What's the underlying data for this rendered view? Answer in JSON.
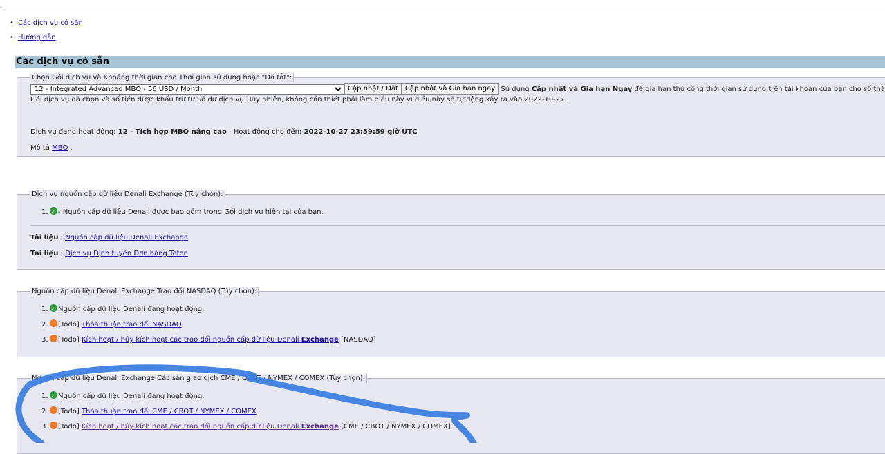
{
  "toc": [
    {
      "label": "Các dịch vụ có sẵn"
    },
    {
      "label": "Hướng dẫn"
    }
  ],
  "section_title": "Các dịch vụ có sẵn",
  "plan": {
    "legend": "Chọn Gói dịch vụ và Khoảng thời gian cho Thời gian sử dụng hoặc \"Đã tắt\":",
    "select_value": "12 - Integrated Advanced MBO - 56 USD / Month",
    "update_button": "Cập nhật / Đặt",
    "renew_button": "Cập nhật và Gia hạn ngay",
    "info_pre": "Sử dụng",
    "info_bold": "Cập nhật và Gia hạn Ngay",
    "info_mid": "để gia hạn",
    "info_link": "thủ công",
    "info_post": "thời gian sử dụng trên tài khoản của bạn cho số tháng v",
    "info_line2": "Gói dịch vụ đã chọn và số tiền được khấu trừ từ Số dư dịch vụ. Tuy nhiên, không cần thiết phải làm điều này vì điều này sẽ tự động xảy ra vào 2022-10-27.",
    "active_label": "Dịch vụ đang hoạt động:",
    "active_value": "12 - Tích hợp MBO nâng cao",
    "active_mid": "- Hoạt động cho đến:",
    "active_until": "2022-10-27 23:59:59 giờ UTC",
    "desc_label": "Mô tả",
    "desc_link": "MBO",
    "desc_end": "."
  },
  "denali": {
    "legend": "Dịch vụ nguồn cấp dữ liệu Denali Exchange (Tùy chọn):",
    "item1_text": "- Nguồn cấp dữ liệu Denali được bao gồm trong Gói dịch vụ hiện tại của bạn.",
    "doc_label": "Tài liệu",
    "doc_sep": ":",
    "doc1_link": "Nguồn cấp dữ liệu Denali Exchange",
    "doc2_link": "Dịch vụ Định tuyến Đơn hàng Teton"
  },
  "nasdaq": {
    "legend": "Nguồn cấp dữ liệu Denali Exchange Trao đổi NASDAQ (Tùy chọn):",
    "item1_text": "Nguồn cấp dữ liệu Denali đang hoạt động.",
    "todo": "[Todo]",
    "item2_link": "Thỏa thuận trao đổi NASDAQ",
    "item3_link": "Kích hoạt / hủy kích hoạt các trao đổi nguồn cấp dữ liệu Denali",
    "item3_bold": "Exchange",
    "item3_suffix": "[NASDAQ]"
  },
  "cme": {
    "legend": "Nguồn cấp dữ liệu Denali Exchange Các sàn giao dịch CME / CBOT / NYMEX / COMEX (Tùy chọn):",
    "item1_text": "Nguồn cấp dữ liệu Denali đang hoạt động.",
    "todo": "[Todo]",
    "item2_link": "Thỏa thuận trao đổi CME / CBOT / NYMEX / COMEX",
    "item3_link": "Kích hoạt / hủy kích hoạt các trao đổi nguồn cấp dữ liệu Denali",
    "item3_bold": "Exchange",
    "item3_suffix": "[CME / CBOT / NYMEX / COMEX]"
  },
  "colors": {
    "header_bg": "#a7c4d6",
    "box_bg": "#e8e8f3",
    "ok_green": "#2d9b36",
    "todo_orange": "#f07a25",
    "scribble_blue": "#3d7fe0"
  }
}
